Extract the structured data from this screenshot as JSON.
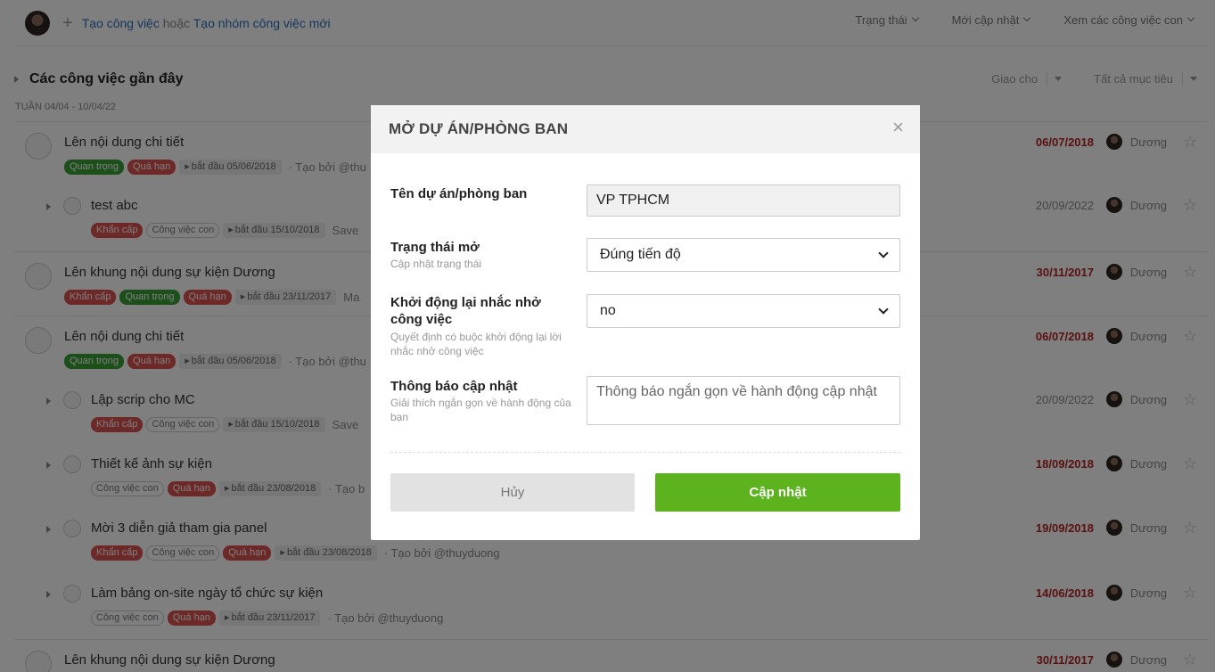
{
  "header": {
    "create_task": "Tạo công việc",
    "or": "hoặc",
    "create_group": "Tạo nhóm công việc mới",
    "filters": [
      "Trạng thái",
      "Mới cập nhật",
      "Xem các công việc con"
    ]
  },
  "section": {
    "title": "Các công việc gần đây",
    "week": "TUẦN 04/04 - 10/04/22",
    "assign_filter": "Giao cho",
    "goal_filter": "Tất cả mục tiêu"
  },
  "tasks": [
    {
      "title": "Lên nội dung chi tiết",
      "tags": [
        "Quan trọng",
        "Quá hạn"
      ],
      "start": "bắt đầu 05/06/2018",
      "creator": "· Tạo bởi @thu",
      "due": "06/07/2018",
      "assignee": "Dương"
    },
    {
      "title": "test abc",
      "tags": [
        "Khẩn cấp",
        "Công việc con"
      ],
      "start": "bắt đầu 15/10/2018",
      "creator": "Save",
      "due": "20/09/2022",
      "assignee": "Dương"
    },
    {
      "title": "Lên khung nội dung sự kiện Dương",
      "tags": [
        "Khẩn cấp",
        "Quan trọng",
        "Quá hạn"
      ],
      "start": "bắt đầu 23/11/2017",
      "creator": "Ma",
      "due": "30/11/2017",
      "assignee": "Dương"
    },
    {
      "title": "Lên nội dung chi tiết",
      "tags": [
        "Quan trọng",
        "Quá hạn"
      ],
      "start": "bắt đầu 05/06/2018",
      "creator": "· Tạo bởi @thu",
      "due": "06/07/2018",
      "assignee": "Dương"
    },
    {
      "title": "Lập scrip cho MC",
      "tags": [
        "Khẩn cấp",
        "Công việc con"
      ],
      "start": "bắt đầu 15/10/2018",
      "creator": "Save",
      "due": "20/09/2022",
      "assignee": "Dương"
    },
    {
      "title": "Thiết kế ảnh sự kiện",
      "tags": [
        "Công việc con",
        "Quá hạn"
      ],
      "start": "bắt đầu 23/08/2018",
      "creator": "· Tạo b",
      "due": "18/09/2018",
      "assignee": "Dương"
    },
    {
      "title": "Mời 3 diễn giả tham gia panel",
      "tags": [
        "Khẩn cấp",
        "Công việc con",
        "Quá hạn"
      ],
      "start": "bắt đầu 23/08/2018",
      "creator": "· Tạo bởi @thuyduong",
      "due": "19/09/2018",
      "assignee": "Dương"
    },
    {
      "title": "Làm bảng on-site ngày tổ chức sự kiện",
      "tags": [
        "Công việc con",
        "Quá hạn"
      ],
      "start": "bắt đầu 23/11/2017",
      "creator": "· Tạo bởi @thuyduong",
      "due": "14/06/2018",
      "assignee": "Dương"
    },
    {
      "title": "Lên khung nội dung sự kiện Dương",
      "tags": [],
      "start": "",
      "creator": "",
      "due": "30/11/2017",
      "assignee": "Dương"
    }
  ],
  "modal": {
    "title": "MỞ DỰ ÁN/PHÒNG BAN",
    "close_icon": "close-icon",
    "project_label": "Tên dự án/phòng ban",
    "project_value": "VP TPHCM",
    "status_label": "Trạng thái mở",
    "status_hint": "Cập nhật trạng thái",
    "status_value": "Đúng tiến độ",
    "restart_label": "Khởi động lại nhắc nhở công việc",
    "restart_hint": "Quyết định có buộc khởi động lại lời nhắc nhở công việc",
    "restart_value": "no",
    "message_label": "Thông báo cập nhật",
    "message_hint": "Giải thích ngắn gọn về hành động của bạn",
    "message_placeholder": "Thông báo ngắn gọn về hành động cập nhật",
    "cancel_label": "Hủy",
    "update_label": "Cập nhật"
  },
  "colors": {
    "accent_green": "#5cb31e",
    "link_blue": "#2a6ebb",
    "overdue_red": "#b22222",
    "tag_green": "#3a9e34",
    "tag_red": "#d9534f"
  }
}
